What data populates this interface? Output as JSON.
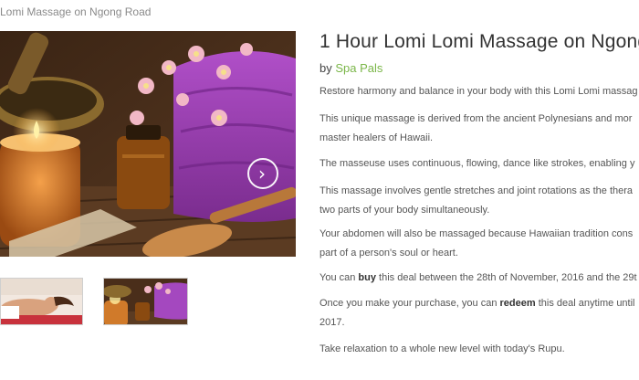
{
  "breadcrumb": "Lomi Massage on Ngong Road",
  "deal": {
    "title": "1 Hour Lomi Lomi Massage on Ngong",
    "by_prefix": "by",
    "vendor": "Spa Pals"
  },
  "description": {
    "p1": "Restore harmony and balance in your body with this Lomi Lomi massag",
    "p2_l1": "This unique massage is derived from the ancient Polynesians and mor",
    "p2_l2": "master healers of Hawaii.",
    "p3": "The masseuse uses continuous, flowing, dance like strokes, enabling y",
    "p4_l1": "This massage involves gentle stretches and joint rotations as the thera",
    "p4_l2": "two parts of your body simultaneously.",
    "p5_l1": "Your abdomen will also be massaged because Hawaiian tradition cons",
    "p5_l2": "part of a person's soul or heart.",
    "p6_pre": "You can",
    "p6_bold": "buy",
    "p6_post": "this deal between the 28th of November, 2016 and the 29t",
    "p7_pre": "Once you make your purchase, you can",
    "p7_bold": "redeem",
    "p7_post": "this deal anytime until",
    "p7_l2": "2017.",
    "p8": "Take relaxation to a whole new level with today's Rupu."
  },
  "gallery": {
    "next_icon": "chevron-right-icon",
    "thumbnails": [
      "spa-woman-thumbnail",
      "spa-still-life-thumbnail"
    ]
  },
  "colors": {
    "vendor_link": "#7ab648",
    "title": "#333333",
    "body": "#555555"
  }
}
